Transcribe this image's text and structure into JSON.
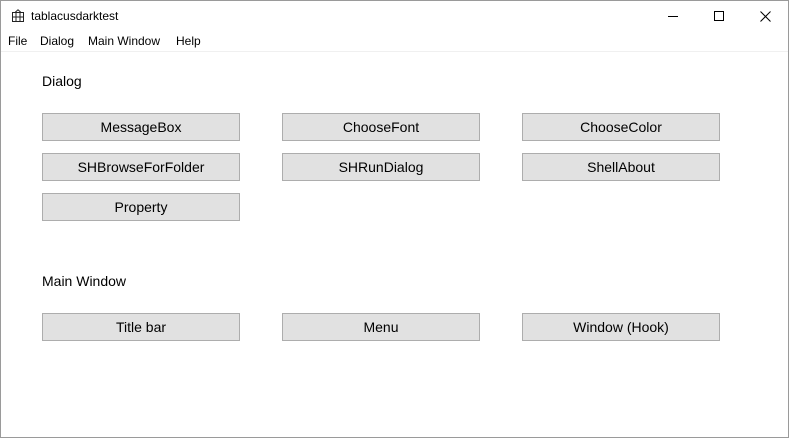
{
  "window": {
    "title": "tablacusdarktest"
  },
  "menu": {
    "items": [
      "File",
      "Dialog",
      "Main Window",
      "Help"
    ]
  },
  "dialog_section": {
    "label": "Dialog",
    "buttons": [
      "MessageBox",
      "ChooseFont",
      "ChooseColor",
      "SHBrowseForFolder",
      "SHRunDialog",
      "ShellAbout",
      "Property"
    ]
  },
  "main_window_section": {
    "label": "Main Window",
    "buttons": [
      "Title bar",
      "Menu",
      "Window (Hook)"
    ]
  },
  "icons": {
    "app": "app-grid-icon",
    "minimize": "minimize-icon",
    "maximize": "maximize-icon",
    "close": "close-icon"
  }
}
